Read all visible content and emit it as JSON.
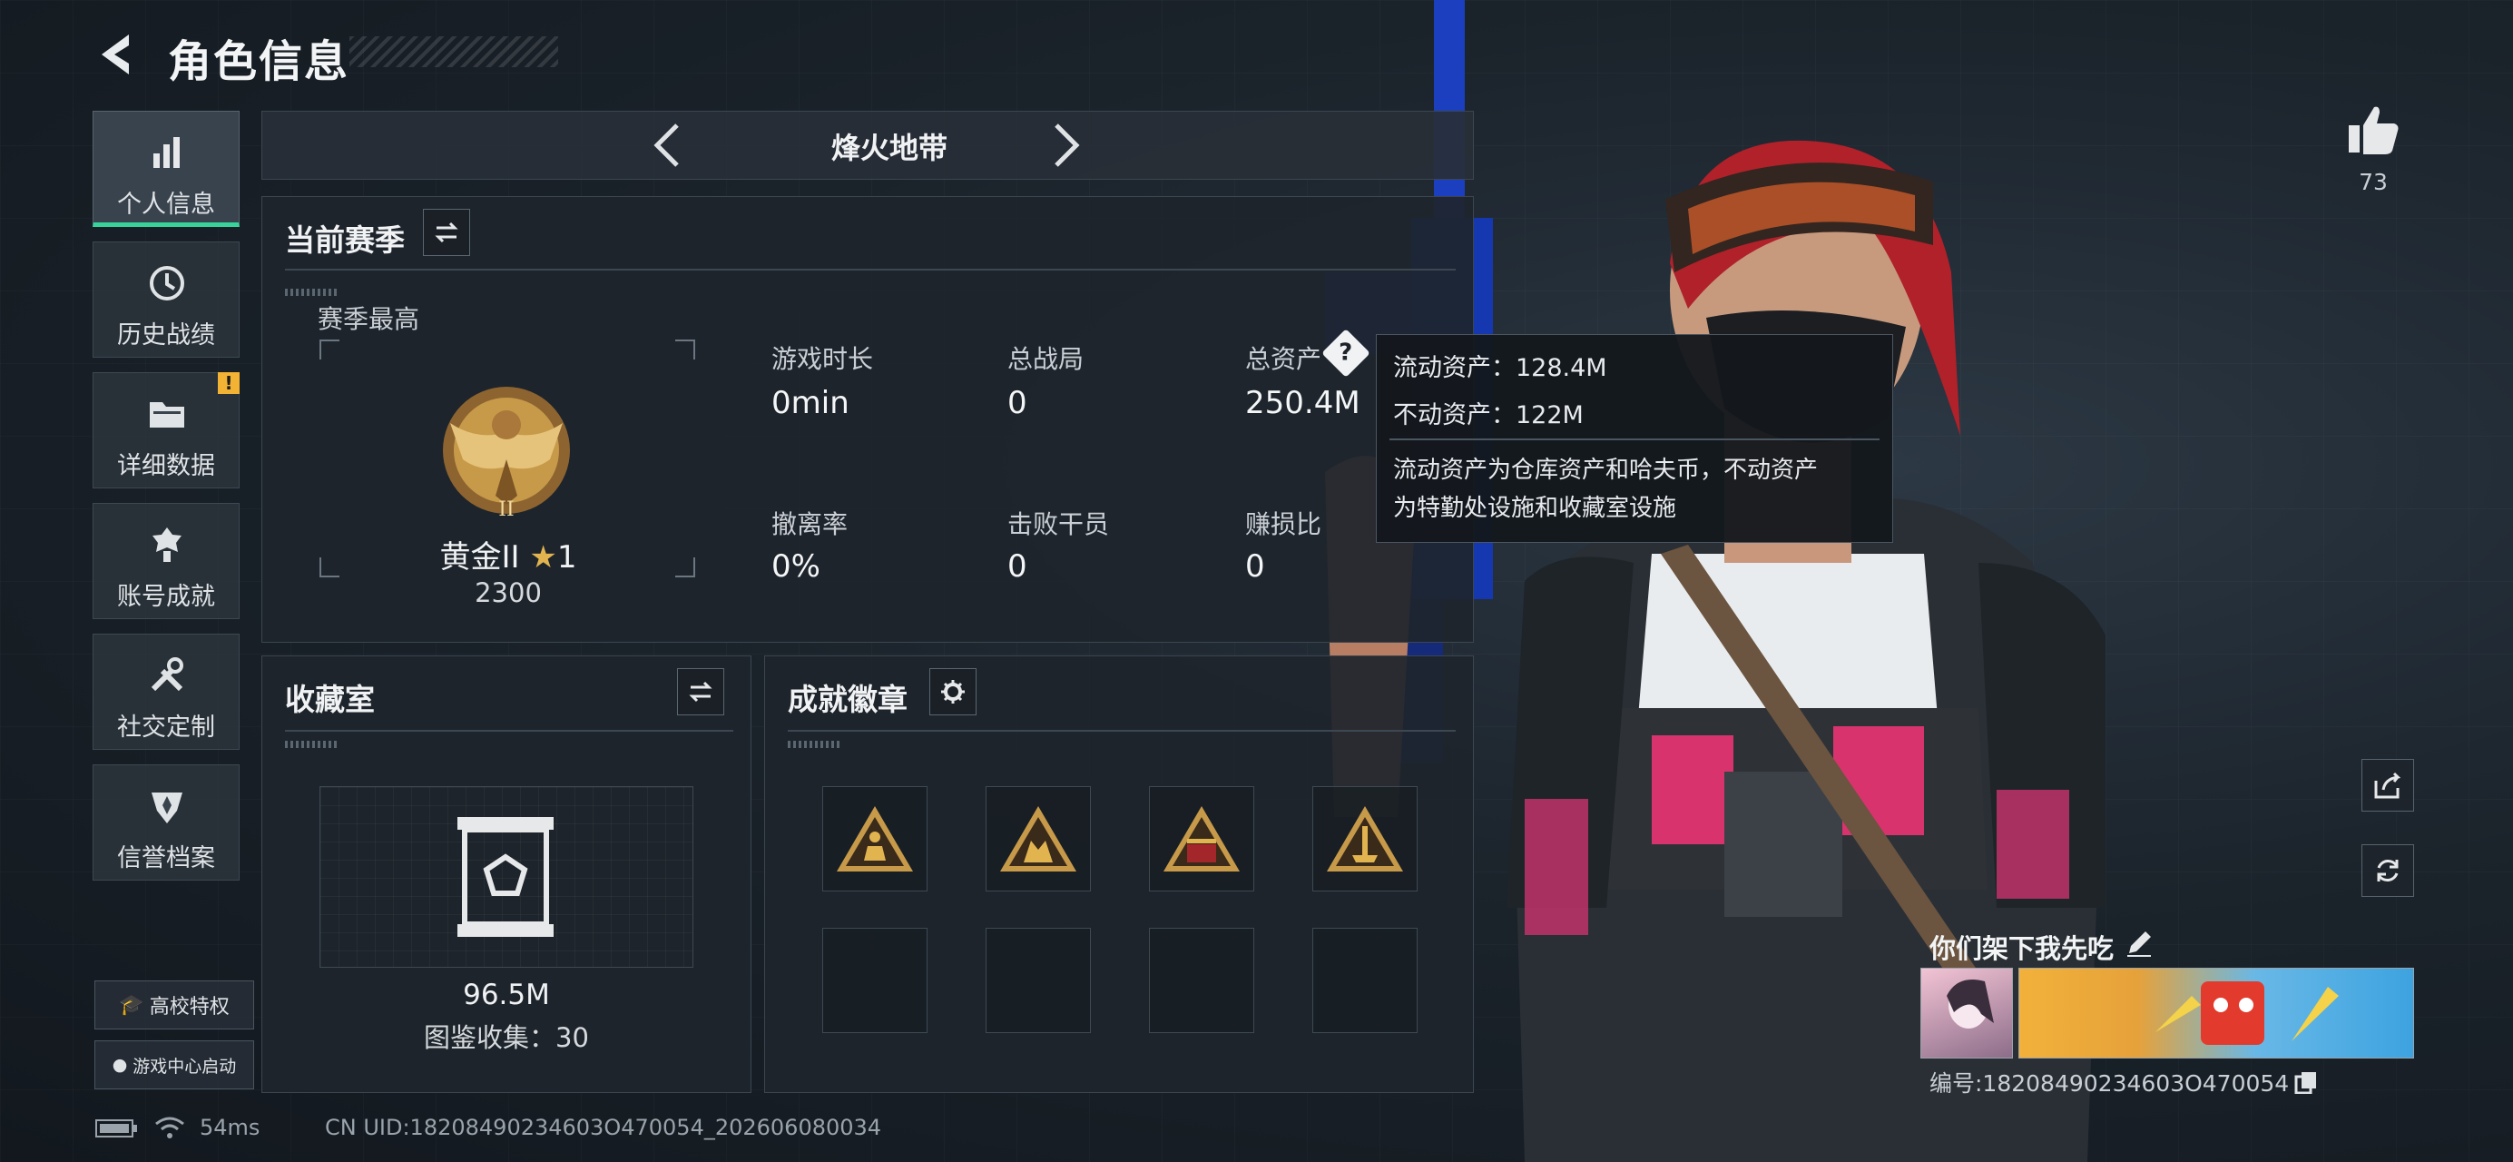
{
  "header": {
    "title": "角色信息"
  },
  "sidebar": {
    "items": [
      {
        "label": "个人信息",
        "icon": "bar-chart-icon",
        "active": true
      },
      {
        "label": "历史战绩",
        "icon": "clock-history-icon"
      },
      {
        "label": "详细数据",
        "icon": "folder-icon",
        "badge": "!"
      },
      {
        "label": "账号成就",
        "icon": "medal-icon"
      },
      {
        "label": "社交定制",
        "icon": "tools-icon"
      },
      {
        "label": "信誉档案",
        "icon": "shield-emblem-icon"
      }
    ],
    "campus_button": "高校特权",
    "gamecenter_button": "游戏中心启动"
  },
  "mode_selector": {
    "label": "烽火地带"
  },
  "season_panel": {
    "title": "当前赛季",
    "best_label": "赛季最高",
    "rank_name": "黄金II",
    "rank_stars": "1",
    "rank_score": "2300",
    "stats": [
      {
        "label": "游戏时长",
        "value": "0min"
      },
      {
        "label": "总战局",
        "value": "0"
      },
      {
        "label": "总资产",
        "value": "250.4M"
      },
      {
        "label": "撤离率",
        "value": "0%"
      },
      {
        "label": "击败干员",
        "value": "0"
      },
      {
        "label": "赚损比",
        "value": "0"
      }
    ]
  },
  "tooltip": {
    "liquid": "流动资产：128.4M",
    "fixed": "不动资产：122M",
    "desc_line1": "流动资产为仓库资产和哈夫币，不动资产",
    "desc_line2": "为特勤处设施和收藏室设施"
  },
  "collection_panel": {
    "title": "收藏室",
    "value": "96.5M",
    "collect_label": "图鉴收集：30"
  },
  "achievement_panel": {
    "title": "成就徽章",
    "badges": [
      "badge-runner-icon",
      "badge-squad-icon",
      "badge-vault-icon",
      "badge-soldier-icon"
    ]
  },
  "right": {
    "likes": "73",
    "player_name": "你们架下我先吃",
    "player_id": "编号:18208490234603O470054"
  },
  "footer": {
    "ping": "54ms",
    "uid": "CN UID:18208490234603O470054_202606080034"
  },
  "colors": {
    "accent": "#37d39a",
    "warning": "#f2b233",
    "gold": "#c79a4a"
  }
}
